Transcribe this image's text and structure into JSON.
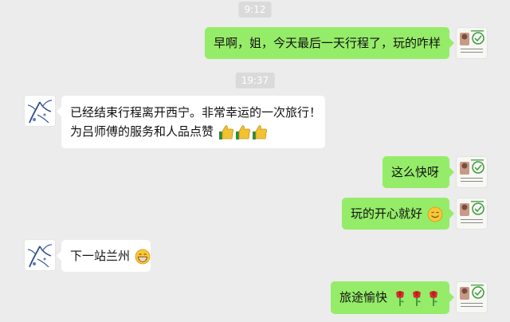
{
  "timestamps": [
    "9:12",
    "19:37"
  ],
  "messages": [
    {
      "side": "me",
      "text": "早啊，姐，今天最后一天行程了，玩的咋样"
    },
    {
      "side": "them",
      "line1": "已经结束行程离开西宁。非常幸运的一次旅行！",
      "line2": "为吕师傅的服务和人品点赞",
      "emoji": [
        "thumbs-up-icon",
        "thumbs-up-icon",
        "thumbs-up-icon"
      ]
    },
    {
      "side": "me",
      "text": "这么快呀"
    },
    {
      "side": "me",
      "text": "玩的开心就好",
      "emoji": [
        "smile-icon"
      ]
    },
    {
      "side": "them",
      "text": "下一站兰州",
      "emoji": [
        "grin-icon"
      ]
    },
    {
      "side": "me",
      "text": "旅途愉快",
      "emoji": [
        "rose-icon",
        "rose-icon",
        "rose-icon"
      ]
    }
  ],
  "colors": {
    "background": "#ececec",
    "my_bubble": "#95ec69",
    "their_bubble": "#ffffff",
    "timestamp_bg": "#dadada"
  }
}
